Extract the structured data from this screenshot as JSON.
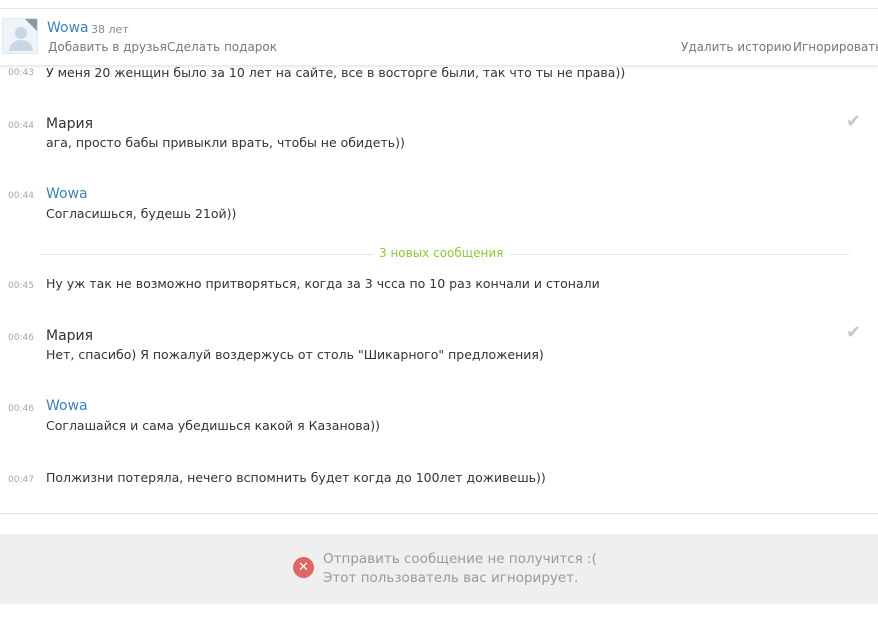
{
  "header": {
    "name": "Wowa",
    "age": "38 лет",
    "add_friend": "Добавить в друзья",
    "gift": "Сделать подарок",
    "delete_history": "Удалить историю",
    "ignore": "Игнорировать"
  },
  "messages": [
    {
      "time": "00:43",
      "author": "",
      "text": "У меня 20 женщин было за 10 лет на сайте, все в восторге были, так что ты не права))"
    },
    {
      "time": "00:44",
      "author": "Мария",
      "text": "ага, просто бабы привыкли врать, чтобы не обидеть))"
    },
    {
      "time": "00:44",
      "author": "Wowa",
      "text": "Согласишься, будешь 21ой))"
    },
    {
      "time": "00:45",
      "author": "",
      "text": "Ну уж так не возможно притворяться, когда за 3 чсса по 10 раз кончали и стонали"
    },
    {
      "time": "00:46",
      "author": "Мария",
      "text": "Нет, спасибо) Я пожалуй воздержусь от столь \"Шикарного\" предложения)"
    },
    {
      "time": "00:46",
      "author": "Wowa",
      "text": "Соглашайся и сама убедишься какой я Казанова))"
    },
    {
      "time": "00:47",
      "author": "",
      "text": "Полжизни потеряла, нечего вспомнить будет когда до 100лет доживешь))"
    }
  ],
  "new_messages_label": "3 новых сообщения",
  "read_mark": "✔",
  "footer": {
    "error_line1": "Отправить сообщение не получится :(",
    "error_line2": "Этот пользователь вас игнорирует.",
    "error_icon_glyph": "✕"
  },
  "colors": {
    "link_blue": "#3d82b8",
    "new_divider_green": "#8cc63f",
    "error_red": "#e06666"
  }
}
